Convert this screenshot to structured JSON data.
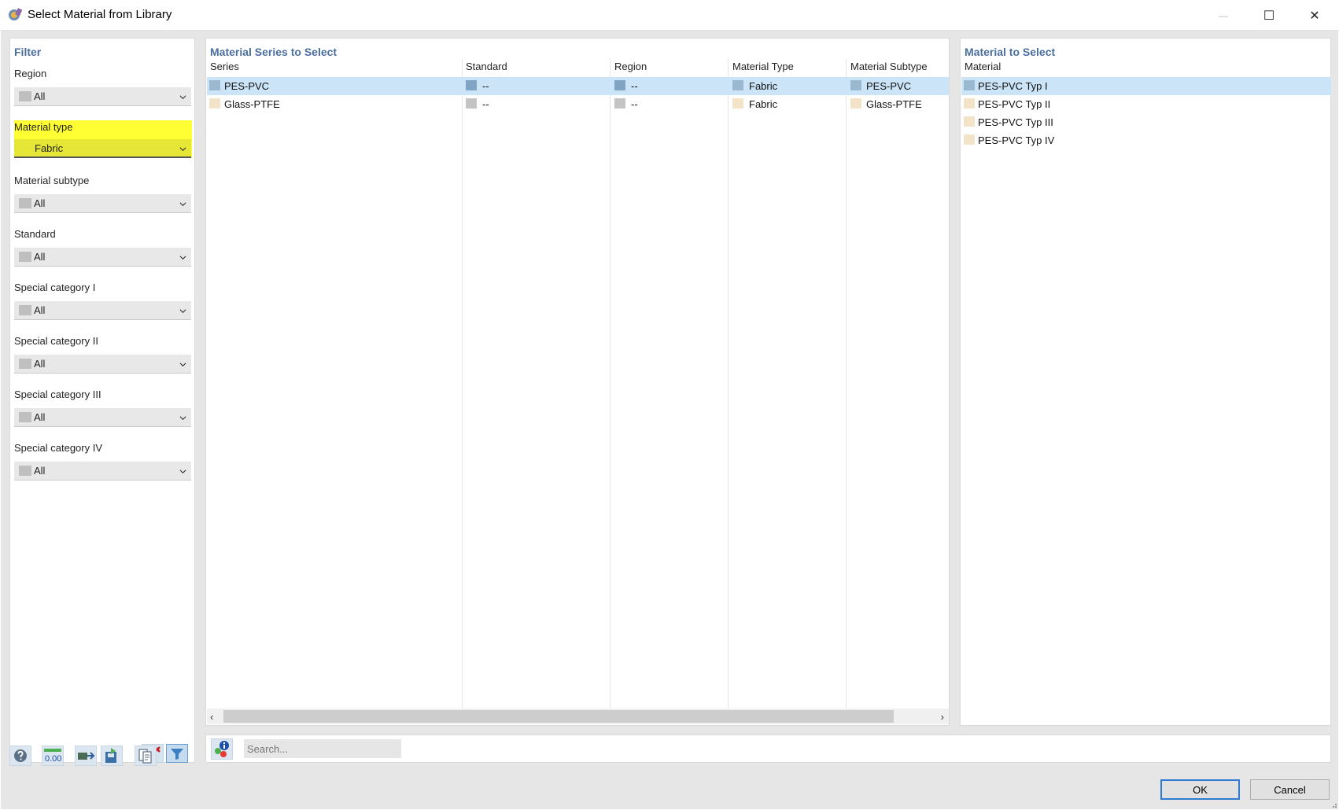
{
  "window": {
    "title": "Select Material from Library",
    "minimize_glyph": "—",
    "maximize_glyph": "☐",
    "close_glyph": "✕"
  },
  "filter": {
    "heading": "Filter",
    "groups": [
      {
        "label": "Region",
        "value": "All"
      },
      {
        "label": "Material type",
        "value": "Fabric"
      },
      {
        "label": "Material subtype",
        "value": "All"
      },
      {
        "label": "Standard",
        "value": "All"
      },
      {
        "label": "Special category I",
        "value": "All"
      },
      {
        "label": "Special category II",
        "value": "All"
      },
      {
        "label": "Special category III",
        "value": "All"
      },
      {
        "label": "Special category IV",
        "value": "All"
      }
    ],
    "highlight_color": "#ffff33"
  },
  "series": {
    "heading": "Material Series to Select",
    "columns": [
      "Series",
      "Standard",
      "Region",
      "Material Type",
      "Material Subtype"
    ],
    "rows": [
      {
        "series": "PES-PVC",
        "standard": "--",
        "region": "--",
        "type": "Fabric",
        "subtype": "PES-PVC",
        "selected": true
      },
      {
        "series": "Glass-PTFE",
        "standard": "--",
        "region": "--",
        "type": "Fabric",
        "subtype": "Glass-PTFE",
        "selected": false
      }
    ],
    "scroll_left": "‹",
    "scroll_right": "›"
  },
  "material": {
    "heading": "Material to Select",
    "column": "Material",
    "items": [
      "PES-PVC Typ I",
      "PES-PVC Typ II",
      "PES-PVC Typ III",
      "PES-PVC Typ IV"
    ],
    "selected_index": 0
  },
  "search": {
    "placeholder": "Search..."
  },
  "buttons": {
    "ok": "OK",
    "cancel": "Cancel"
  },
  "colors": {
    "accent": "#4a6e9e",
    "selection": "#cce4f7",
    "ok_border": "#2f7bd1"
  },
  "icons": {
    "toolbar": [
      "help-icon",
      "decimal-icon",
      "import-icon",
      "save-library-icon",
      "library-info-icon"
    ],
    "filter_buttons": [
      "clear-filter-icon",
      "filter-icon"
    ],
    "info": "info-icon"
  }
}
